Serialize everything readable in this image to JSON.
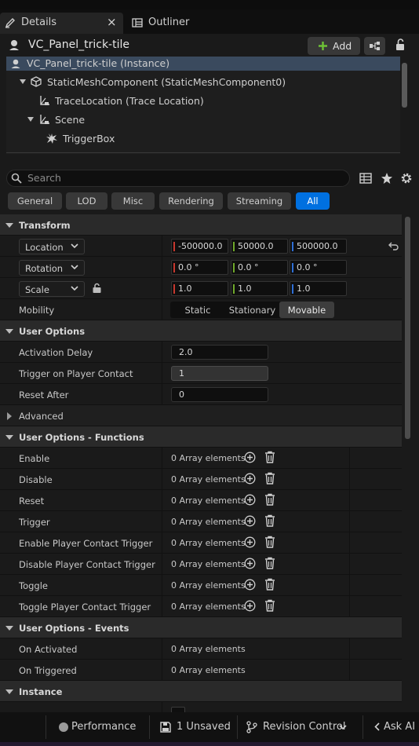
{
  "tabs": [
    {
      "label": "Details",
      "close": "×"
    },
    {
      "label": "Outliner"
    }
  ],
  "header": {
    "title": "VC_Panel_trick-tile",
    "add_label": "Add"
  },
  "tree": [
    {
      "label": "VC_Panel_trick-tile (Instance)",
      "icon": "actor-icon"
    },
    {
      "label": "StaticMeshComponent (StaticMeshComponent0)",
      "icon": "cube-icon"
    },
    {
      "label": "TraceLocation (Trace Location)",
      "icon": "scene-component-icon"
    },
    {
      "label": "Scene",
      "icon": "scene-component-icon"
    },
    {
      "label": "TriggerBox",
      "icon": "trigger-icon"
    }
  ],
  "search": {
    "placeholder": "Search"
  },
  "filters": [
    "General",
    "LOD",
    "Misc",
    "Rendering",
    "Streaming",
    "All"
  ],
  "selected_filter": "All",
  "transform": {
    "category": "Transform",
    "location": {
      "label": "Location",
      "values": [
        "-500000.0",
        "50000.0",
        "500000.0"
      ]
    },
    "rotation": {
      "label": "Rotation",
      "values": [
        "0.0 °",
        "0.0 °",
        "0.0 °"
      ]
    },
    "scale": {
      "label": "Scale",
      "values": [
        "1.0",
        "1.0",
        "1.0"
      ]
    },
    "mobility": {
      "label": "Mobility",
      "options": [
        "Static",
        "Stationary",
        "Movable"
      ],
      "selected": "Movable"
    }
  },
  "user_options": {
    "category": "User Options",
    "activation_delay": {
      "label": "Activation Delay",
      "value": "2.0"
    },
    "trigger_on_contact": {
      "label": "Trigger on Player Contact",
      "value": "1"
    },
    "reset_after": {
      "label": "Reset After",
      "value": "0"
    }
  },
  "advanced": {
    "label": "Advanced"
  },
  "functions": {
    "category": "User Options - Functions",
    "items": [
      {
        "label": "Enable",
        "value": "0 Array elements"
      },
      {
        "label": "Disable",
        "value": "0 Array elements"
      },
      {
        "label": "Reset",
        "value": "0 Array elements"
      },
      {
        "label": "Trigger",
        "value": "0 Array elements"
      },
      {
        "label": "Enable Player Contact Trigger",
        "value": "0 Array elements"
      },
      {
        "label": "Disable Player Contact Trigger",
        "value": "0 Array elements"
      },
      {
        "label": "Toggle",
        "value": "0 Array elements"
      },
      {
        "label": "Toggle Player Contact Trigger",
        "value": "0 Array elements"
      }
    ]
  },
  "events": {
    "category": "User Options - Events",
    "items": [
      {
        "label": "On Activated",
        "value": "0 Array elements"
      },
      {
        "label": "On Triggered",
        "value": "0 Array elements"
      }
    ]
  },
  "instance": {
    "category": "Instance"
  },
  "statusbar": {
    "performance": "Performance",
    "unsaved": "1 Unsaved",
    "revision": "Revision Control",
    "ask_ai": "Ask AI"
  },
  "colors": {
    "accent": "#0070e0",
    "axis_x": "#c8382e",
    "axis_y": "#6fa82a",
    "axis_z": "#2f6fd6",
    "add_plus": "#6ec236",
    "tree_selected": "#3a4a5e"
  }
}
